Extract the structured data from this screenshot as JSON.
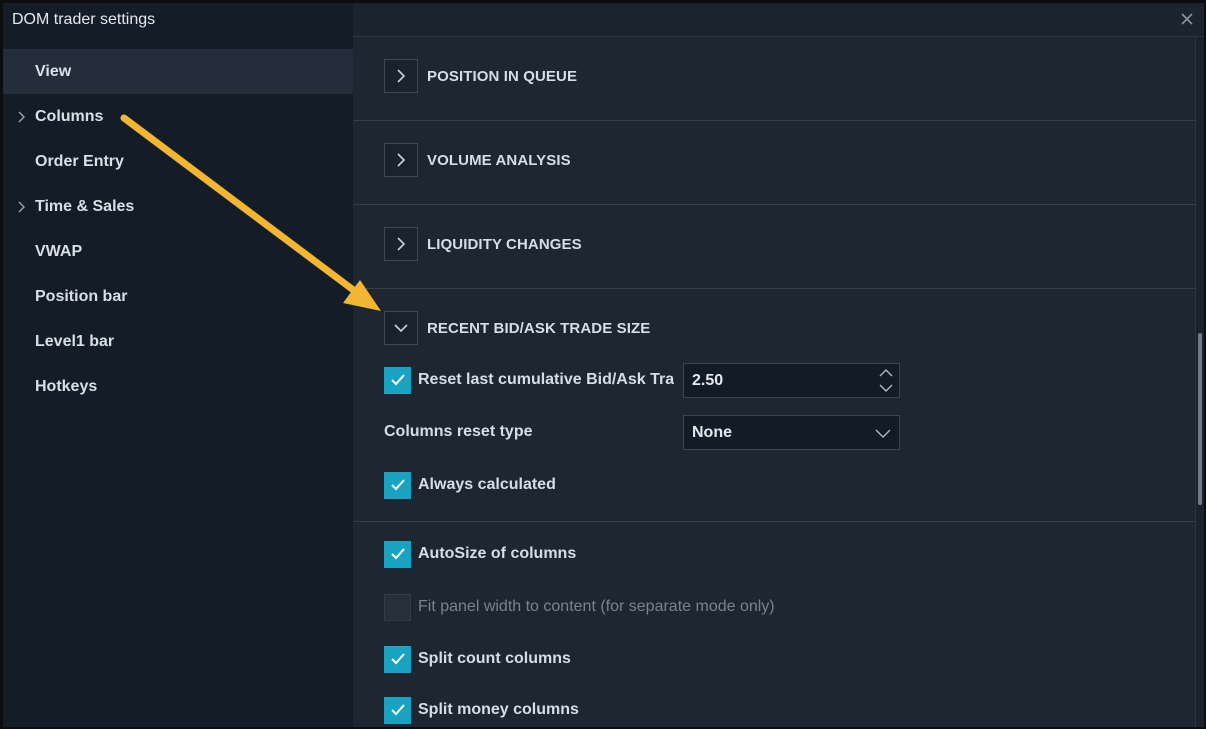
{
  "window": {
    "title": "DOM trader settings"
  },
  "sidebar": {
    "items": [
      {
        "label": "View",
        "active": true,
        "expandable": false
      },
      {
        "label": "Columns",
        "active": false,
        "expandable": true
      },
      {
        "label": "Order Entry",
        "active": false,
        "expandable": false
      },
      {
        "label": "Time & Sales",
        "active": false,
        "expandable": true
      },
      {
        "label": "VWAP",
        "active": false,
        "expandable": false
      },
      {
        "label": "Position bar",
        "active": false,
        "expandable": false
      },
      {
        "label": "Level1 bar",
        "active": false,
        "expandable": false
      },
      {
        "label": "Hotkeys",
        "active": false,
        "expandable": false
      }
    ]
  },
  "sections": [
    {
      "title": "POSITION IN QUEUE",
      "expanded": false
    },
    {
      "title": "VOLUME ANALYSIS",
      "expanded": false
    },
    {
      "title": "LIQUIDITY CHANGES",
      "expanded": false
    },
    {
      "title": "RECENT BID/ASK TRADE SIZE",
      "expanded": true,
      "reset_last": {
        "label": "Reset last cumulative Bid/Ask Trade size",
        "checked": true,
        "value": "2.50"
      },
      "columns_reset_type": {
        "label": "Columns reset type",
        "value": "None"
      },
      "always_calculated": {
        "label": "Always calculated",
        "checked": true
      }
    }
  ],
  "options": [
    {
      "label": "AutoSize of columns",
      "checked": true,
      "enabled": true
    },
    {
      "label": "Fit panel width to content (for separate mode only)",
      "checked": false,
      "enabled": false
    },
    {
      "label": "Split count columns",
      "checked": true,
      "enabled": true
    },
    {
      "label": "Split money columns",
      "checked": true,
      "enabled": true
    }
  ],
  "colors": {
    "accent": "#18a3c2",
    "callout_arrow": "#f2b632",
    "sidebar_bg": "#141c27",
    "content_bg": "#1d2631"
  }
}
